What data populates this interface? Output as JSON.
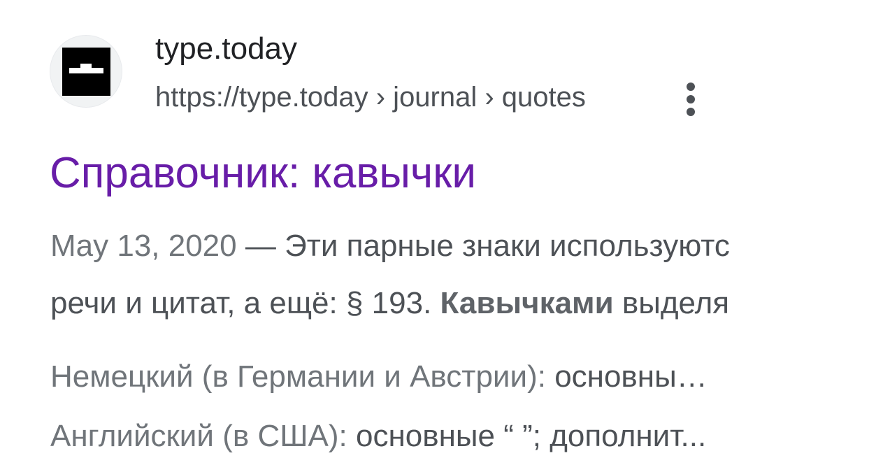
{
  "result": {
    "site_name": "type.today",
    "site_url": "https://type.today › journal › quotes",
    "favicon_icon": "type-today-logo-icon",
    "more_icon": "more-vert-icon",
    "title": "Справочник: кавычки",
    "title_color": "#681da8",
    "snippet": {
      "date": "May 13, 2020",
      "line1_text": " — Эти парные знаки используютс",
      "line2_before": "речи и цитат, а ещё: § 193. ",
      "line2_emphasis": "Кавычками",
      "line2_after": " выделя"
    },
    "sitelinks": [
      {
        "label": "Немецкий (в Германии и Австрии): ",
        "text": "основны…"
      },
      {
        "label": "Английский (в США): ",
        "text": "основные “ ”; дополнит..."
      }
    ]
  }
}
